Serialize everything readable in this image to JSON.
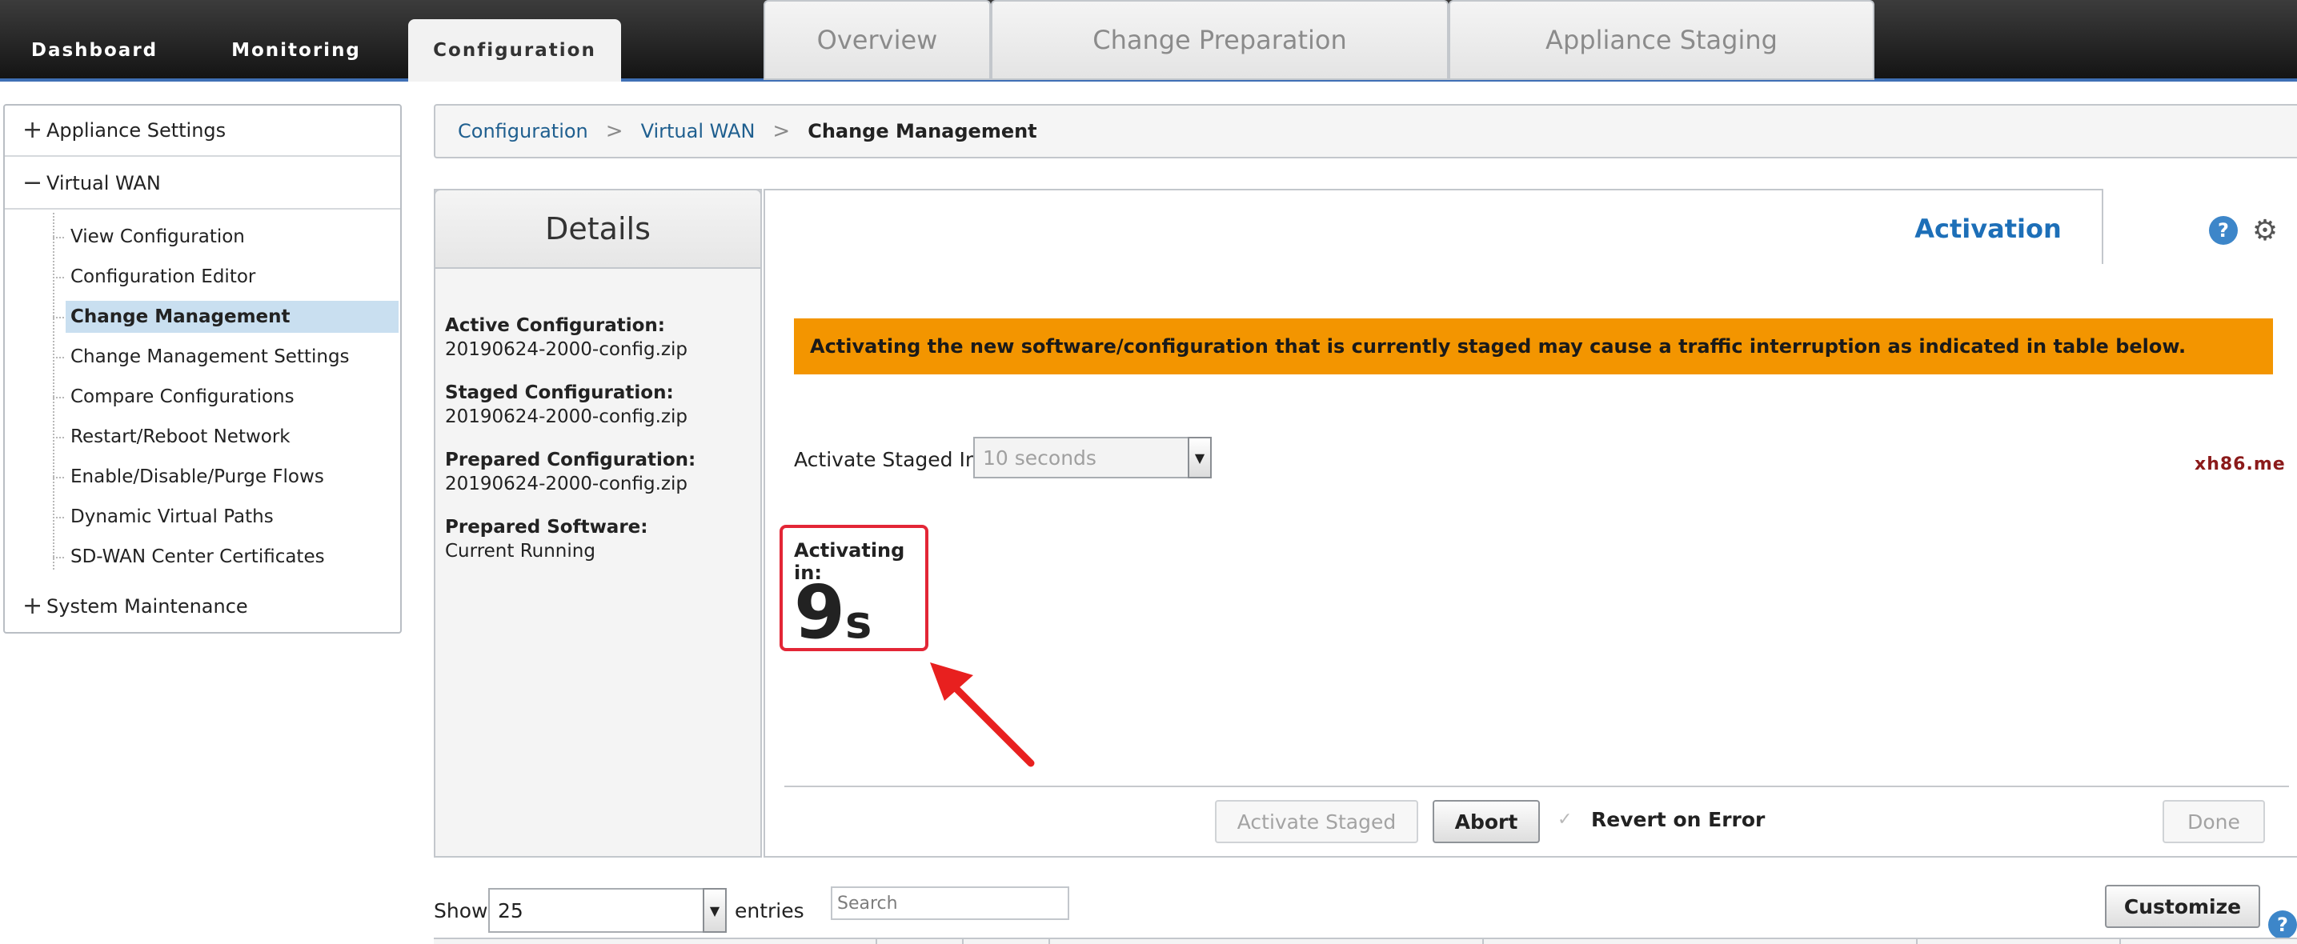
{
  "top_nav": {
    "tabs": [
      {
        "label": "Dashboard"
      },
      {
        "label": "Monitoring"
      },
      {
        "label": "Configuration"
      }
    ]
  },
  "sidebar": {
    "groups": [
      {
        "sign": "+",
        "label": "Appliance Settings"
      },
      {
        "sign": "−",
        "label": "Virtual WAN"
      },
      {
        "sign": "+",
        "label": "System Maintenance"
      }
    ],
    "items": [
      {
        "label": "View Configuration"
      },
      {
        "label": "Configuration Editor"
      },
      {
        "label": "Change Management"
      },
      {
        "label": "Change Management Settings"
      },
      {
        "label": "Compare Configurations"
      },
      {
        "label": "Restart/Reboot Network"
      },
      {
        "label": "Enable/Disable/Purge Flows"
      },
      {
        "label": "Dynamic Virtual Paths"
      },
      {
        "label": "SD-WAN Center Certificates"
      }
    ]
  },
  "breadcrumb": {
    "items": [
      "Configuration",
      "Virtual WAN",
      "Change Management"
    ],
    "separator": ">"
  },
  "details": {
    "title": "Details",
    "fields": [
      {
        "label": "Active Configuration:",
        "value": "20190624-2000-config.zip"
      },
      {
        "label": "Staged Configuration:",
        "value": "20190624-2000-config.zip"
      },
      {
        "label": "Prepared Configuration:",
        "value": "20190624-2000-config.zip"
      },
      {
        "label": "Prepared Software:",
        "value": "Current Running"
      }
    ]
  },
  "tabs": [
    {
      "label": "Overview"
    },
    {
      "label": "Change Preparation"
    },
    {
      "label": "Appliance Staging"
    },
    {
      "label": "Activation"
    }
  ],
  "header_icons": {
    "help": "?",
    "help_icon": "help-icon",
    "settings_icon": "gear-icon"
  },
  "activation": {
    "warning": "Activating the new software/configuration that is currently staged may cause a traffic interruption as indicated in table below.",
    "activate_in_label": "Activate Staged In:",
    "activate_in_value": "10 seconds",
    "countdown_label": "Activating in:",
    "countdown_value": "9",
    "countdown_unit": "s",
    "watermark": "xh86.me"
  },
  "actions": {
    "activate_staged": "Activate Staged",
    "abort": "Abort",
    "revert_on_error": "Revert on Error",
    "revert_checked": true,
    "done": "Done"
  },
  "table_controls": {
    "show_label": "Show",
    "entries_value": "25",
    "entries_label": "entries",
    "search_placeholder": "Search",
    "customize": "Customize",
    "help": "?"
  },
  "colors": {
    "accent": "#1d6fb8",
    "warning_bg": "#f39500",
    "highlight_border": "#e32636",
    "selected_row": "#c9dff0"
  }
}
